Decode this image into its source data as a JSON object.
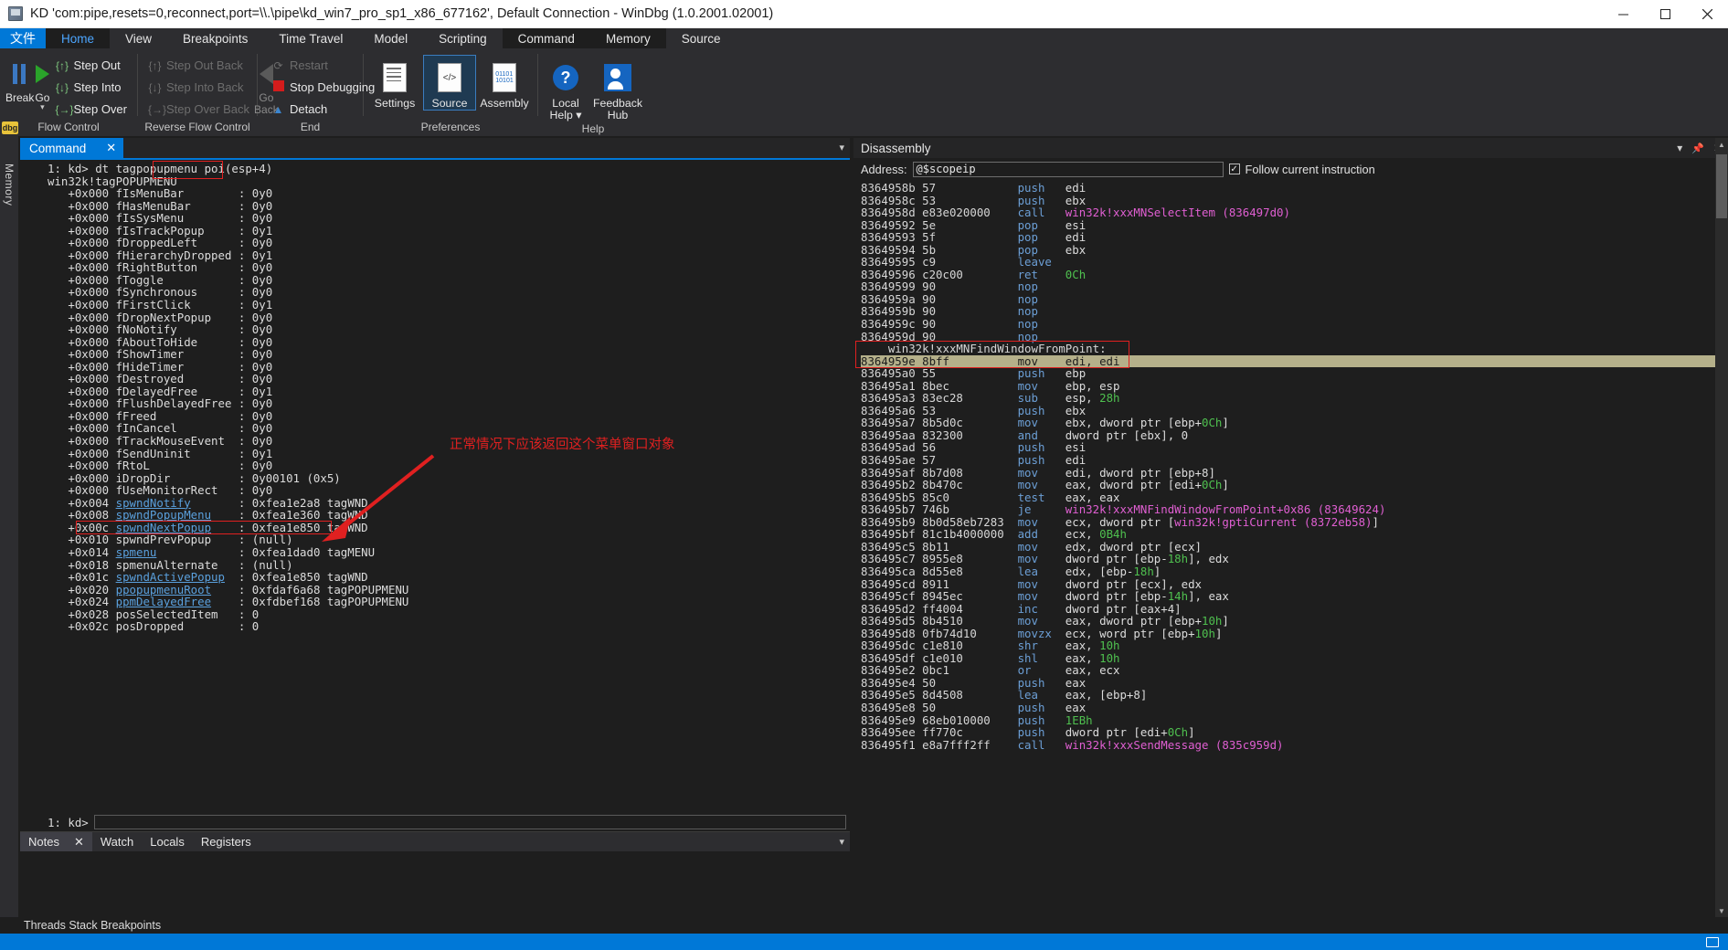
{
  "window": {
    "title": "KD 'com:pipe,resets=0,reconnect,port=\\\\.\\pipe\\kd_win7_pro_sp1_x86_677162', Default Connection  - WinDbg (1.0.2001.02001)",
    "minimize_label": "–",
    "maximize_label": "❐",
    "close_label": "✕",
    "app_icon": "windbg-icon"
  },
  "ribbon": {
    "file_tab": "文件",
    "tabs": [
      {
        "label": "Home",
        "active": true
      },
      {
        "label": "View",
        "active": false
      },
      {
        "label": "Breakpoints",
        "active": false
      },
      {
        "label": "Time Travel",
        "active": false
      },
      {
        "label": "Model",
        "active": false
      },
      {
        "label": "Scripting",
        "active": false
      },
      {
        "label": "Command",
        "active": false,
        "highlight": true
      },
      {
        "label": "Memory",
        "active": false,
        "highlight": true
      },
      {
        "label": "Source",
        "active": false
      }
    ],
    "groups": [
      {
        "name": "Flow Control",
        "label": "Flow Control",
        "big": [
          {
            "label": "Break",
            "icon": "pause-icon"
          },
          {
            "label": "Go",
            "icon": "play-icon",
            "dropdown": true
          }
        ],
        "small": [
          {
            "label": "Step Out",
            "icon": "step-out-icon",
            "disabled": false
          },
          {
            "label": "Step Into",
            "icon": "step-into-icon",
            "disabled": false
          },
          {
            "label": "Step Over",
            "icon": "step-over-icon",
            "disabled": false
          }
        ]
      },
      {
        "name": "Reverse Flow Control",
        "label": "Reverse Flow Control",
        "small": [
          {
            "label": "Step Out Back",
            "icon": "step-out-back-icon",
            "disabled": true
          },
          {
            "label": "Step Into Back",
            "icon": "step-into-back-icon",
            "disabled": true
          },
          {
            "label": "Step Over Back",
            "icon": "step-over-back-icon",
            "disabled": true
          }
        ],
        "big": [
          {
            "label": "Go Back",
            "icon": "go-back-icon",
            "disabled": true
          }
        ]
      },
      {
        "name": "End",
        "label": "End",
        "small": [
          {
            "label": "Restart",
            "icon": "restart-icon",
            "disabled": true
          },
          {
            "label": "Stop Debugging",
            "icon": "stop-icon",
            "disabled": false
          },
          {
            "label": "Detach",
            "icon": "detach-icon",
            "disabled": false
          }
        ]
      },
      {
        "name": "Preferences",
        "label": "Preferences",
        "med": [
          {
            "label": "Settings",
            "icon": "settings-doc-icon",
            "selected": false
          },
          {
            "label": "Source",
            "icon": "source-doc-icon",
            "selected": true
          },
          {
            "label": "Assembly",
            "icon": "assembly-doc-icon",
            "selected": false
          }
        ]
      },
      {
        "name": "Help",
        "label": "Help",
        "med": [
          {
            "label": "Local Help ▾",
            "icon": "question-icon",
            "selected": false
          },
          {
            "label": "Feedback Hub",
            "icon": "feedback-icon",
            "selected": false
          }
        ]
      }
    ]
  },
  "leftrail": {
    "badge": "dbg",
    "label": "Memory"
  },
  "command_panel": {
    "tab_label": "Command",
    "close_label": "✕",
    "caret": "▾",
    "prompt_line": "1: kd> dt tagpopupmenu ",
    "highlighted_arg": "poi(esp+4)",
    "type_line": "win32k!tagPOPUPMENU",
    "rows": [
      {
        "off": "+0x000",
        "name": "fIsMenuBar",
        "val": "0y0"
      },
      {
        "off": "+0x000",
        "name": "fHasMenuBar",
        "val": "0y0"
      },
      {
        "off": "+0x000",
        "name": "fIsSysMenu",
        "val": "0y0"
      },
      {
        "off": "+0x000",
        "name": "fIsTrackPopup",
        "val": "0y1"
      },
      {
        "off": "+0x000",
        "name": "fDroppedLeft",
        "val": "0y0"
      },
      {
        "off": "+0x000",
        "name": "fHierarchyDropped",
        "val": "0y1"
      },
      {
        "off": "+0x000",
        "name": "fRightButton",
        "val": "0y0"
      },
      {
        "off": "+0x000",
        "name": "fToggle",
        "val": "0y0"
      },
      {
        "off": "+0x000",
        "name": "fSynchronous",
        "val": "0y0"
      },
      {
        "off": "+0x000",
        "name": "fFirstClick",
        "val": "0y1"
      },
      {
        "off": "+0x000",
        "name": "fDropNextPopup",
        "val": "0y0"
      },
      {
        "off": "+0x000",
        "name": "fNoNotify",
        "val": "0y0"
      },
      {
        "off": "+0x000",
        "name": "fAboutToHide",
        "val": "0y0"
      },
      {
        "off": "+0x000",
        "name": "fShowTimer",
        "val": "0y0"
      },
      {
        "off": "+0x000",
        "name": "fHideTimer",
        "val": "0y0"
      },
      {
        "off": "+0x000",
        "name": "fDestroyed",
        "val": "0y0"
      },
      {
        "off": "+0x000",
        "name": "fDelayedFree",
        "val": "0y1"
      },
      {
        "off": "+0x000",
        "name": "fFlushDelayedFree",
        "val": "0y0"
      },
      {
        "off": "+0x000",
        "name": "fFreed",
        "val": "0y0"
      },
      {
        "off": "+0x000",
        "name": "fInCancel",
        "val": "0y0"
      },
      {
        "off": "+0x000",
        "name": "fTrackMouseEvent",
        "val": "0y0"
      },
      {
        "off": "+0x000",
        "name": "fSendUninit",
        "val": "0y1"
      },
      {
        "off": "+0x000",
        "name": "fRtoL",
        "val": "0y0"
      },
      {
        "off": "+0x000",
        "name": "iDropDir",
        "val": "0y00101 (0x5)"
      },
      {
        "off": "+0x000",
        "name": "fUseMonitorRect",
        "val": "0y0"
      },
      {
        "off": "+0x004",
        "name": "spwndNotify",
        "val": "0xfea1e2a8 tagWND",
        "link": true
      },
      {
        "off": "+0x008",
        "name": "spwndPopupMenu",
        "val": "0xfea1e360 tagWND",
        "link": true
      },
      {
        "off": "+0x00c",
        "name": "spwndNextPopup",
        "val": "0xfea1e850 tagWND",
        "link": true,
        "boxed": true
      },
      {
        "off": "+0x010",
        "name": "spwndPrevPopup",
        "val": "(null)"
      },
      {
        "off": "+0x014",
        "name": "spmenu",
        "val": "0xfea1dad0 tagMENU",
        "link": true
      },
      {
        "off": "+0x018",
        "name": "spmenuAlternate",
        "val": "(null)"
      },
      {
        "off": "+0x01c",
        "name": "spwndActivePopup",
        "val": "0xfea1e850 tagWND",
        "link": true
      },
      {
        "off": "+0x020",
        "name": "ppopupmenuRoot",
        "val": "0xfdaf6a68 tagPOPUPMENU",
        "link": true
      },
      {
        "off": "+0x024",
        "name": "ppmDelayedFree",
        "val": "0xfdbef168 tagPOPUPMENU",
        "link": true
      },
      {
        "off": "+0x028",
        "name": "posSelectedItem",
        "val": "0"
      },
      {
        "off": "+0x02c",
        "name": "posDropped",
        "val": "0"
      }
    ],
    "annotation": "正常情况下应该返回这个菜单窗口对象",
    "annotation_color": "#e02020",
    "input_prompt": "1: kd>",
    "input_value": ""
  },
  "notes_bar": {
    "tabs": [
      {
        "label": "Notes",
        "active": true,
        "closable": true
      },
      {
        "label": "Watch",
        "active": false
      },
      {
        "label": "Locals",
        "active": false
      },
      {
        "label": "Registers",
        "active": false
      }
    ],
    "close_label": "✕",
    "caret": "▾"
  },
  "disassembly": {
    "title": "Disassembly",
    "caret": "▾",
    "pin": "📌",
    "close": "✕",
    "address_label": "Address:",
    "address_value": "@$scopeip",
    "follow_label": "Follow current instruction",
    "follow_checked": true,
    "check_glyph": "✓",
    "rows": [
      {
        "addr": "8364958b",
        "bytes": "57",
        "mn": "push",
        "op": "edi"
      },
      {
        "addr": "8364958c",
        "bytes": "53",
        "mn": "push",
        "op": "ebx"
      },
      {
        "addr": "8364958d",
        "bytes": "e83e020000",
        "mn": "call",
        "sym": "win32k!xxxMNSelectItem (836497d0)"
      },
      {
        "addr": "83649592",
        "bytes": "5e",
        "mn": "pop",
        "op": "esi"
      },
      {
        "addr": "83649593",
        "bytes": "5f",
        "mn": "pop",
        "op": "edi"
      },
      {
        "addr": "83649594",
        "bytes": "5b",
        "mn": "pop",
        "op": "ebx"
      },
      {
        "addr": "83649595",
        "bytes": "c9",
        "mn": "leave",
        "op": ""
      },
      {
        "addr": "83649596",
        "bytes": "c20c00",
        "mn": "ret",
        "num": "0Ch"
      },
      {
        "addr": "83649599",
        "bytes": "90",
        "mn": "nop",
        "op": ""
      },
      {
        "addr": "8364959a",
        "bytes": "90",
        "mn": "nop",
        "op": ""
      },
      {
        "addr": "8364959b",
        "bytes": "90",
        "mn": "nop",
        "op": ""
      },
      {
        "addr": "8364959c",
        "bytes": "90",
        "mn": "nop",
        "op": ""
      },
      {
        "addr": "8364959d",
        "bytes": "90",
        "mn": "nop",
        "op": ""
      },
      {
        "label": "    win32k!xxxMNFindWindowFromPoint:",
        "is_label": true,
        "boxed": true
      },
      {
        "addr": "8364959e",
        "bytes": "8bff",
        "mn": "mov",
        "op": "edi, edi",
        "current": true,
        "boxed": true
      },
      {
        "addr": "836495a0",
        "bytes": "55",
        "mn": "push",
        "op": "ebp"
      },
      {
        "addr": "836495a1",
        "bytes": "8bec",
        "mn": "mov",
        "op": "ebp, esp"
      },
      {
        "addr": "836495a3",
        "bytes": "83ec28",
        "mn": "sub",
        "op": "esp, ",
        "num": "28h"
      },
      {
        "addr": "836495a6",
        "bytes": "53",
        "mn": "push",
        "op": "ebx"
      },
      {
        "addr": "836495a7",
        "bytes": "8b5d0c",
        "mn": "mov",
        "op": "ebx, dword ptr [ebp+",
        "num": "0Ch",
        "op2": "]"
      },
      {
        "addr": "836495aa",
        "bytes": "832300",
        "mn": "and",
        "op": "dword ptr [ebx], 0"
      },
      {
        "addr": "836495ad",
        "bytes": "56",
        "mn": "push",
        "op": "esi"
      },
      {
        "addr": "836495ae",
        "bytes": "57",
        "mn": "push",
        "op": "edi"
      },
      {
        "addr": "836495af",
        "bytes": "8b7d08",
        "mn": "mov",
        "op": "edi, dword ptr [ebp+8]"
      },
      {
        "addr": "836495b2",
        "bytes": "8b470c",
        "mn": "mov",
        "op": "eax, dword ptr [edi+",
        "num": "0Ch",
        "op2": "]"
      },
      {
        "addr": "836495b5",
        "bytes": "85c0",
        "mn": "test",
        "op": "eax, eax"
      },
      {
        "addr": "836495b7",
        "bytes": "746b",
        "mn": "je",
        "sym": "win32k!xxxMNFindWindowFromPoint+0x86 (83649624)"
      },
      {
        "addr": "836495b9",
        "bytes": "8b0d58eb7283",
        "mn": "mov",
        "op": "ecx, dword ptr [",
        "sym2": "win32k!gptiCurrent (8372eb58)",
        "op2": "]"
      },
      {
        "addr": "836495bf",
        "bytes": "81c1b4000000",
        "mn": "add",
        "op": "ecx, ",
        "num": "0B4h"
      },
      {
        "addr": "836495c5",
        "bytes": "8b11",
        "mn": "mov",
        "op": "edx, dword ptr [ecx]"
      },
      {
        "addr": "836495c7",
        "bytes": "8955e8",
        "mn": "mov",
        "op": "dword ptr [ebp-",
        "num": "18h",
        "op2": "], edx"
      },
      {
        "addr": "836495ca",
        "bytes": "8d55e8",
        "mn": "lea",
        "op": "edx, [ebp-",
        "num": "18h",
        "op2": "]"
      },
      {
        "addr": "836495cd",
        "bytes": "8911",
        "mn": "mov",
        "op": "dword ptr [ecx], edx"
      },
      {
        "addr": "836495cf",
        "bytes": "8945ec",
        "mn": "mov",
        "op": "dword ptr [ebp-",
        "num": "14h",
        "op2": "], eax"
      },
      {
        "addr": "836495d2",
        "bytes": "ff4004",
        "mn": "inc",
        "op": "dword ptr [eax+4]"
      },
      {
        "addr": "836495d5",
        "bytes": "8b4510",
        "mn": "mov",
        "op": "eax, dword ptr [ebp+",
        "num": "10h",
        "op2": "]"
      },
      {
        "addr": "836495d8",
        "bytes": "0fb74d10",
        "mn": "movzx",
        "op": "ecx, word ptr [ebp+",
        "num": "10h",
        "op2": "]"
      },
      {
        "addr": "836495dc",
        "bytes": "c1e810",
        "mn": "shr",
        "op": "eax, ",
        "num": "10h"
      },
      {
        "addr": "836495df",
        "bytes": "c1e010",
        "mn": "shl",
        "op": "eax, ",
        "num": "10h"
      },
      {
        "addr": "836495e2",
        "bytes": "0bc1",
        "mn": "or",
        "op": "eax, ecx"
      },
      {
        "addr": "836495e4",
        "bytes": "50",
        "mn": "push",
        "op": "eax"
      },
      {
        "addr": "836495e5",
        "bytes": "8d4508",
        "mn": "lea",
        "op": "eax, [ebp+8]"
      },
      {
        "addr": "836495e8",
        "bytes": "50",
        "mn": "push",
        "op": "eax"
      },
      {
        "addr": "836495e9",
        "bytes": "68eb010000",
        "mn": "push",
        "num": "1EBh"
      },
      {
        "addr": "836495ee",
        "bytes": "ff770c",
        "mn": "push",
        "op": "dword ptr [edi+",
        "num": "0Ch",
        "op2": "]"
      },
      {
        "addr": "836495f1",
        "bytes": "e8a7fff2ff",
        "mn": "call",
        "sym": "win32k!xxxSendMessage (835c959d)"
      }
    ]
  },
  "statusbar": {
    "text": "Threads Stack Breakpoints"
  },
  "colors": {
    "accent": "#0078d7",
    "annotation_red": "#e02020",
    "highlight_row": "#b5b08a",
    "link_blue": "#5aa0dd",
    "symbol_magenta": "#e05fd2",
    "mnemonic_blue": "#6c9fd6",
    "number_green": "#4fc04f"
  }
}
